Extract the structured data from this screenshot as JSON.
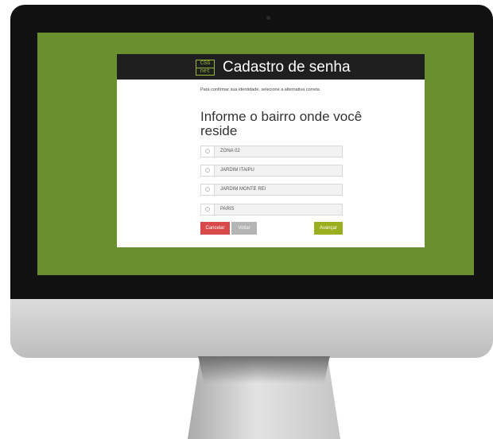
{
  "header": {
    "logo_top": "CSG",
    "logo_bottom": "net",
    "title": "Cadastro de senha"
  },
  "form": {
    "intro": "Para confirmar sua identidade, selecione a alternativa correta",
    "question": "Informe o bairro onde você reside",
    "options": [
      {
        "label": "ZONA 02"
      },
      {
        "label": "JARDIM ITAIPU"
      },
      {
        "label": "JARDIM MONTE REI"
      },
      {
        "label": "PARIS"
      }
    ]
  },
  "actions": {
    "cancel_label": "Cancelar",
    "back_label": "Voltar",
    "next_label": "Avançar"
  },
  "colors": {
    "screen_background": "#6a8f2f",
    "header_background": "#1f1f1f",
    "brand_green": "#9ab838",
    "cancel": "#d84a4a",
    "back": "#b5b5b5",
    "next": "#9aaf1f"
  }
}
